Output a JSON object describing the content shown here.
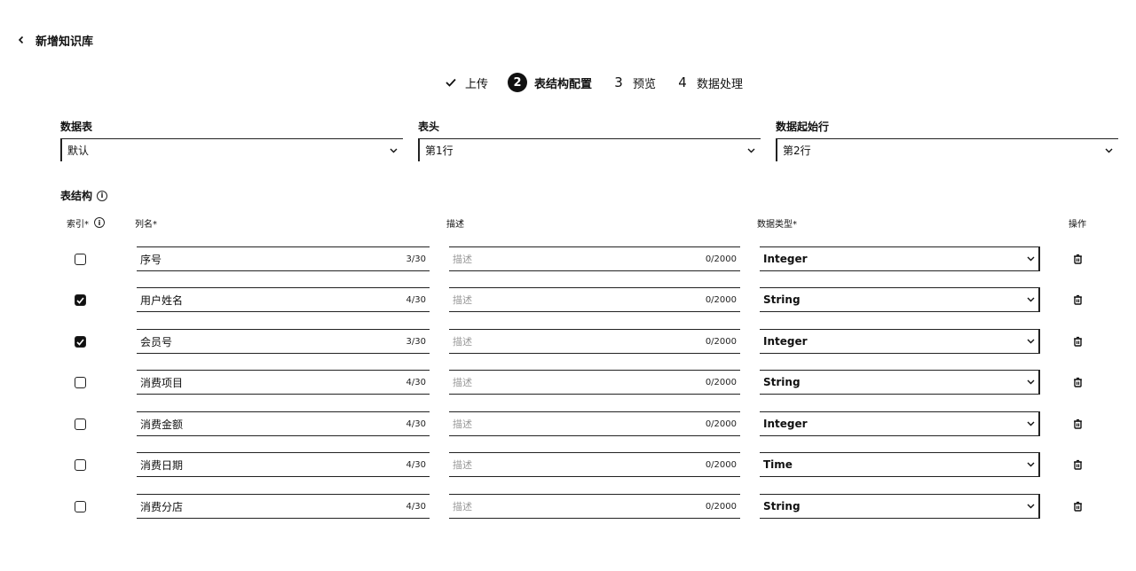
{
  "header": {
    "title": "新增知识库"
  },
  "steps": [
    {
      "number": "",
      "label": "上传",
      "state": "done"
    },
    {
      "number": "2",
      "label": "表结构配置",
      "state": "active"
    },
    {
      "number": "3",
      "label": "预览",
      "state": "pending"
    },
    {
      "number": "4",
      "label": "数据处理",
      "state": "pending"
    }
  ],
  "config": {
    "sheet": {
      "label": "数据表",
      "value": "默认"
    },
    "header_row": {
      "label": "表头",
      "value": "第1行"
    },
    "data_start": {
      "label": "数据起始行",
      "value": "第2行"
    }
  },
  "structure": {
    "title": "表结构",
    "columns": {
      "index": "索引*",
      "name": "列名*",
      "desc": "描述",
      "type": "数据类型*",
      "action": "操作"
    },
    "rows": [
      {
        "index": false,
        "name": "序号",
        "name_count": "3/30",
        "desc_placeholder": "描述",
        "desc_count": "0/2000",
        "type": "Integer"
      },
      {
        "index": true,
        "name": "用户姓名",
        "name_count": "4/30",
        "desc_placeholder": "描述",
        "desc_count": "0/2000",
        "type": "String"
      },
      {
        "index": true,
        "name": "会员号",
        "name_count": "3/30",
        "desc_placeholder": "描述",
        "desc_count": "0/2000",
        "type": "Integer"
      },
      {
        "index": false,
        "name": "消费项目",
        "name_count": "4/30",
        "desc_placeholder": "描述",
        "desc_count": "0/2000",
        "type": "String"
      },
      {
        "index": false,
        "name": "消费金额",
        "name_count": "4/30",
        "desc_placeholder": "描述",
        "desc_count": "0/2000",
        "type": "Integer"
      },
      {
        "index": false,
        "name": "消费日期",
        "name_count": "4/30",
        "desc_placeholder": "描述",
        "desc_count": "0/2000",
        "type": "Time"
      },
      {
        "index": false,
        "name": "消费分店",
        "name_count": "4/30",
        "desc_placeholder": "描述",
        "desc_count": "0/2000",
        "type": "String"
      }
    ]
  }
}
